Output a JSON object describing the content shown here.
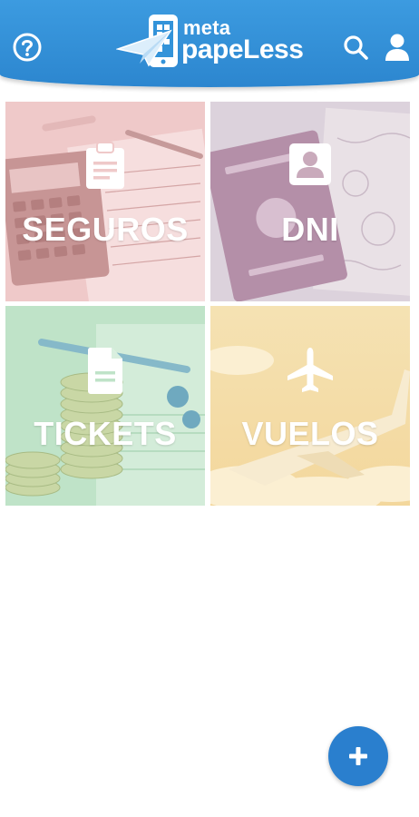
{
  "header": {
    "logo": {
      "small": "meta",
      "big": "papeLess"
    },
    "help_icon": "help-circle-icon",
    "search_icon": "search-icon",
    "user_icon": "user-icon",
    "color": "#3393d9"
  },
  "tiles": [
    {
      "label": "SEGUROS",
      "icon": "clipboard-icon",
      "tint": "#e8b4b4"
    },
    {
      "label": "DNI",
      "icon": "id-card-icon",
      "tint": "#c9a7bd"
    },
    {
      "label": "TICKETS",
      "icon": "document-icon",
      "tint": "#a8d8b4"
    },
    {
      "label": "VUELOS",
      "icon": "airplane-icon",
      "tint": "#f0d8a0"
    }
  ],
  "fab": {
    "label": "+",
    "icon": "plus-icon",
    "color": "#2a7fce"
  }
}
